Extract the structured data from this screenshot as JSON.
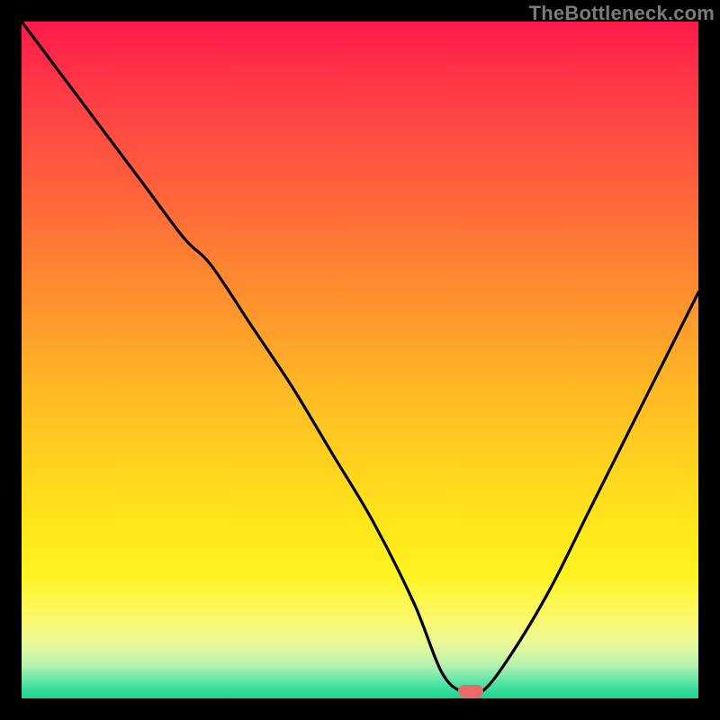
{
  "watermark": "TheBottleneck.com",
  "marker": {
    "x_pct": 66.3,
    "y_pct": 99.0
  },
  "colors": {
    "top": "#ff1a4b",
    "mid": "#ffd21f",
    "bottom": "#14d68f",
    "curve": "#000000",
    "marker": "#e86a6a",
    "frame": "#000000"
  },
  "chart_data": {
    "type": "line",
    "title": "",
    "xlabel": "",
    "ylabel": "",
    "xlim": [
      0,
      100
    ],
    "ylim": [
      0,
      100
    ],
    "legend": false,
    "grid": false,
    "notes": "Bottleneck-style V curve. Y ≈ mismatch/bottleneck percentage (0 = green/optimal at bottom, 100 = red/severe at top). X is an unlabeled normalized axis. Flat near-zero segment around x≈62–68 marks the balance point (pink marker).",
    "series": [
      {
        "name": "bottleneck-curve",
        "x": [
          0,
          6,
          12,
          18,
          24,
          28,
          34,
          40,
          46,
          52,
          58,
          62,
          65,
          68,
          72,
          78,
          84,
          90,
          96,
          100
        ],
        "values": [
          100,
          92,
          84,
          76,
          68,
          64,
          55,
          46,
          36,
          26,
          14,
          4,
          1,
          1,
          6,
          16,
          28,
          40,
          52,
          60
        ]
      }
    ],
    "optimal_point": {
      "x": 66.3,
      "y": 1
    }
  }
}
